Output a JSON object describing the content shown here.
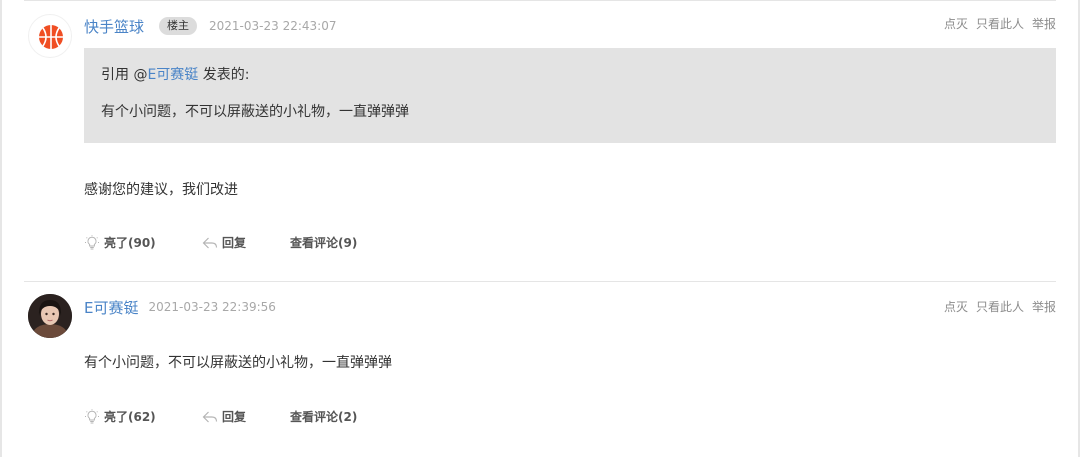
{
  "colors": {
    "link": "#4a84c7",
    "quote_background": "#e3e3e3",
    "muted": "#a8a8a8"
  },
  "posts": [
    {
      "username": "快手篮球",
      "badge": "楼主",
      "time": "2021-03-23 22:43:07",
      "avatar_icon": "basketball-logo-icon",
      "actions": {
        "downvote": "点灭",
        "only_this": "只看此人",
        "report": "举报"
      },
      "quote": {
        "prefix": "引用 @",
        "quoted_user": "E可赛铤",
        "suffix": " 发表的:",
        "text": "有个小问题，不可以屏蔽送的小礼物，一直弹弹弹"
      },
      "content": "感谢您的建议，我们改进",
      "toolbar": {
        "like": "亮了(90)",
        "reply": "回复",
        "comments": "查看评论(9)"
      }
    },
    {
      "username": "E可赛铤",
      "time": "2021-03-23 22:39:56",
      "avatar_icon": "user-photo-avatar",
      "actions": {
        "downvote": "点灭",
        "only_this": "只看此人",
        "report": "举报"
      },
      "content": "有个小问题，不可以屏蔽送的小礼物，一直弹弹弹",
      "toolbar": {
        "like": "亮了(62)",
        "reply": "回复",
        "comments": "查看评论(2)"
      }
    }
  ]
}
